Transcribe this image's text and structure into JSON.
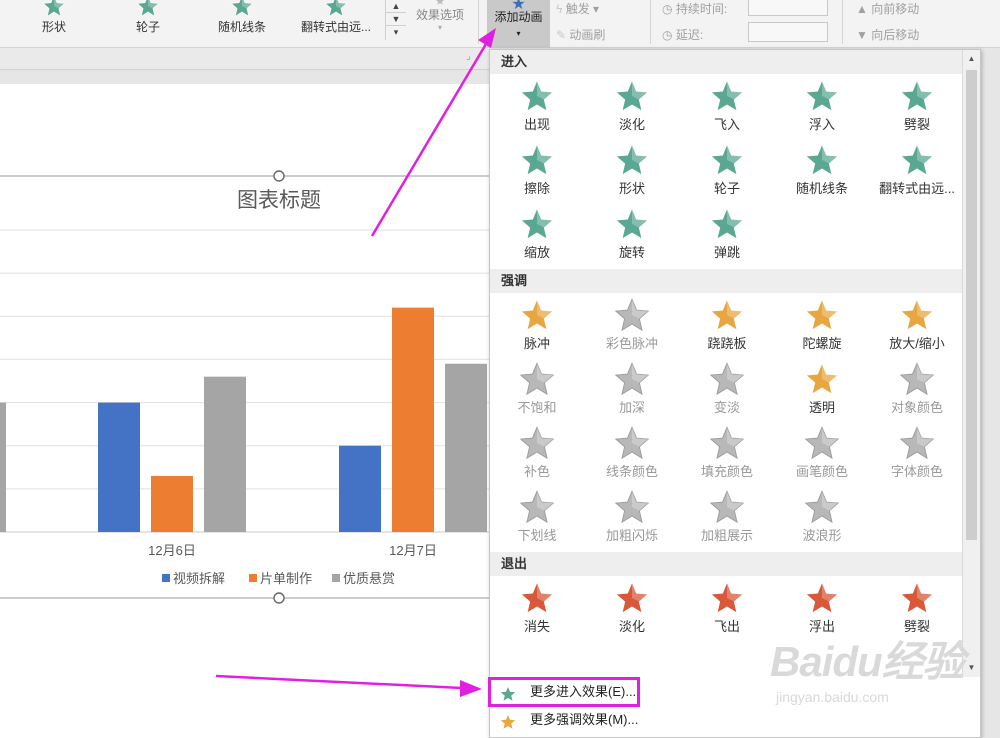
{
  "ribbon": {
    "gallery": [
      {
        "label": "形状",
        "icon": "star-shape-icon"
      },
      {
        "label": "轮子",
        "icon": "star-wheel-icon"
      },
      {
        "label": "随机线条",
        "icon": "star-random-bars-icon"
      },
      {
        "label": "翻转式由远...",
        "icon": "star-grow-turn-icon"
      }
    ],
    "effect_options": "效果选项",
    "add_animation": "添加动画",
    "trigger": "触发",
    "animation_painter": "动画刷",
    "duration_label": "持续时间:",
    "delay_label": "延迟:",
    "move_earlier": "向前移动",
    "move_later": "向后移动"
  },
  "chart": {
    "title": "图表标题",
    "legend": [
      "视频拆解",
      "片单制作",
      "优质悬赏"
    ]
  },
  "chart_data": {
    "type": "bar",
    "title": "图表标题",
    "categories": [
      "12月6日",
      "12月7日"
    ],
    "series": [
      {
        "name": "视频拆解",
        "color": "#4472c4",
        "values": [
          3,
          2
        ]
      },
      {
        "name": "片单制作",
        "color": "#ed7d31",
        "values": [
          1.3,
          5.2
        ]
      },
      {
        "name": "优质悬赏",
        "color": "#a5a5a5",
        "values": [
          3.6,
          3.9
        ]
      }
    ],
    "ylim": [
      0,
      7
    ],
    "grid": true,
    "legend_position": "bottom"
  },
  "panel": {
    "sections": [
      {
        "title": "进入",
        "color": "#5ba892",
        "items": [
          "出现",
          "淡化",
          "飞入",
          "浮入",
          "劈裂",
          "擦除",
          "形状",
          "轮子",
          "随机线条",
          "翻转式由远...",
          "缩放",
          "旋转",
          "弹跳"
        ]
      },
      {
        "title": "强调",
        "color": "#e8a640",
        "items": [
          "脉冲",
          "彩色脉冲",
          "跷跷板",
          "陀螺旋",
          "放大/缩小",
          "不饱和",
          "加深",
          "变淡",
          "透明",
          "对象颜色",
          "补色",
          "线条颜色",
          "填充颜色",
          "画笔颜色",
          "字体颜色",
          "下划线",
          "加粗闪烁",
          "加粗展示",
          "波浪形"
        ]
      },
      {
        "title": "退出",
        "color": "#d9583a",
        "items": [
          "消失",
          "淡化",
          "飞出",
          "浮出",
          "劈裂"
        ]
      }
    ],
    "more_entrance": "更多进入效果(E)...",
    "more_emphasis": "更多强调效果(M)..."
  },
  "watermark": {
    "line1": "Baidu经验",
    "line2": "jingyan.baidu.com"
  }
}
